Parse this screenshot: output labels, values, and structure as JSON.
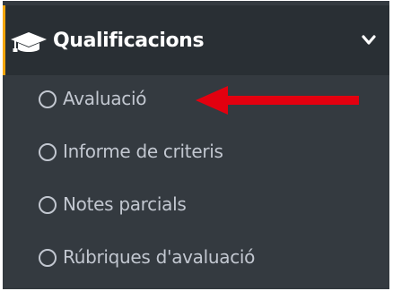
{
  "menu": {
    "title": "Qualificacions",
    "icon": "graduation-cap-icon",
    "expand_icon": "chevron-down-icon",
    "items": [
      {
        "label": "Avaluació",
        "icon": "circle-icon"
      },
      {
        "label": "Informe de criteris",
        "icon": "circle-icon"
      },
      {
        "label": "Notes parcials",
        "icon": "circle-icon"
      },
      {
        "label": "Rúbriques d'avaluació",
        "icon": "circle-icon"
      }
    ]
  },
  "annotation": {
    "icon": "red-arrow-icon",
    "color": "#e3000f",
    "points_to": "Avaluació"
  },
  "colors": {
    "sidebar_bg": "#343a40",
    "header_bg": "#292f34",
    "accent": "#f6a609",
    "text": "#c2c7d0",
    "header_text": "#ffffff"
  }
}
